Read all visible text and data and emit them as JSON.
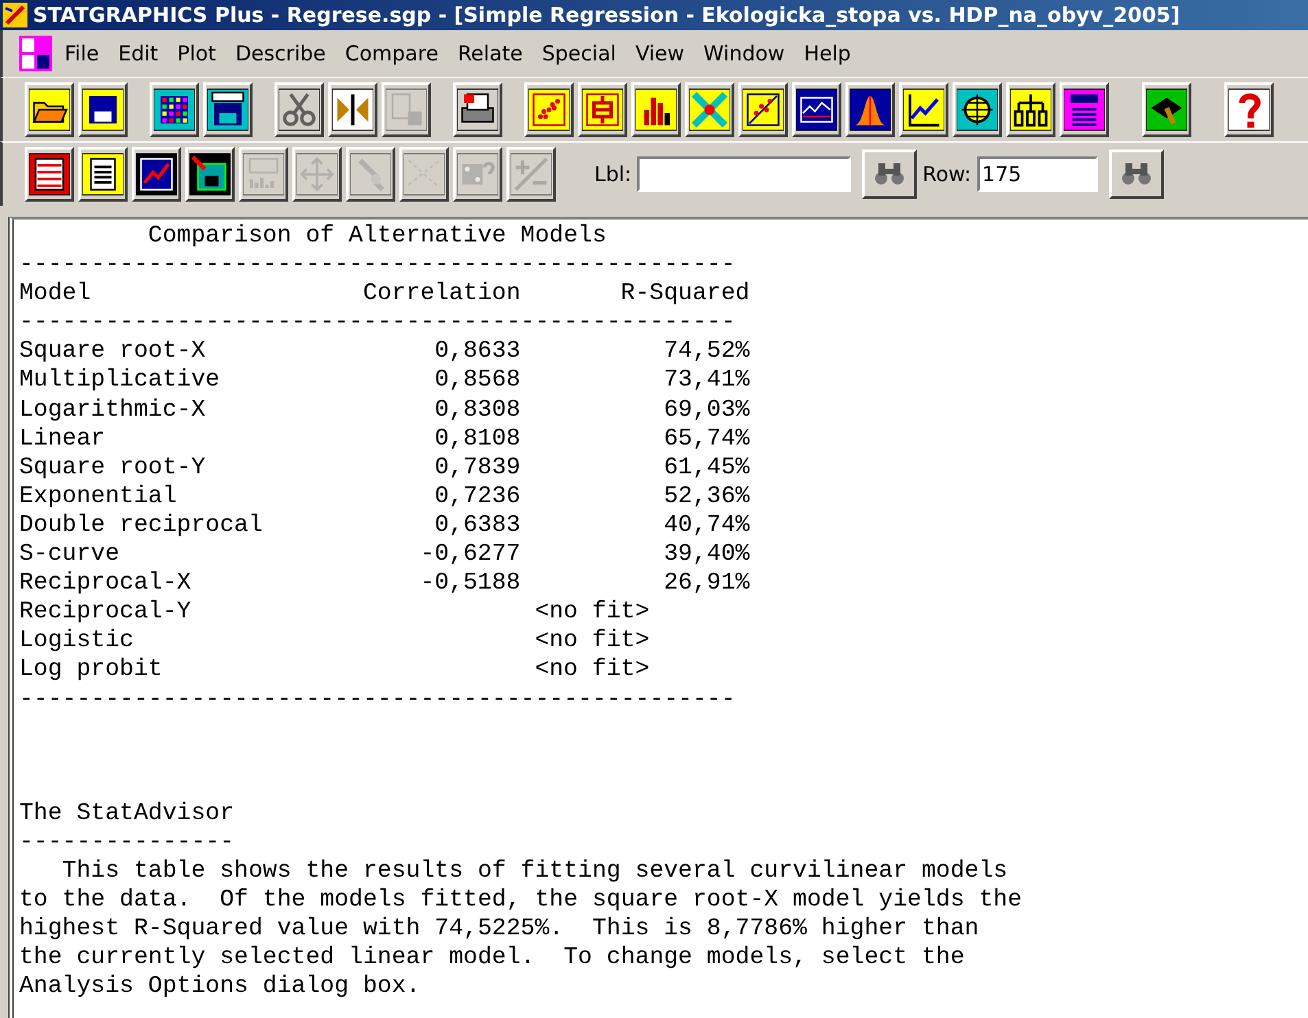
{
  "window": {
    "title": "STATGRAPHICS Plus - Regrese.sgp - [Simple Regression - Ekologicka_stopa vs. HDP_na_obyv_2005]"
  },
  "menu": [
    "File",
    "Edit",
    "Plot",
    "Describe",
    "Compare",
    "Relate",
    "Special",
    "View",
    "Window",
    "Help"
  ],
  "toolbar_1": [
    {
      "disabled": false
    },
    {
      "disabled": false
    },
    {
      "disabled": false
    },
    {
      "disabled": false
    },
    {
      "disabled": false
    },
    {
      "disabled": false
    },
    {
      "disabled": true
    },
    {
      "disabled": false
    },
    {
      "disabled": false
    },
    {
      "disabled": false
    },
    {
      "disabled": false
    },
    {
      "disabled": false
    },
    {
      "disabled": false
    },
    {
      "disabled": false
    },
    {
      "disabled": false
    },
    {
      "disabled": false
    },
    {
      "disabled": false
    },
    {
      "disabled": false
    },
    {
      "disabled": false
    },
    {
      "disabled": false
    },
    {
      "disabled": false
    }
  ],
  "toolbar_2": {
    "buttons": [
      {
        "disabled": false
      },
      {
        "disabled": false
      },
      {
        "disabled": false
      },
      {
        "disabled": false
      },
      {
        "disabled": true
      },
      {
        "disabled": true
      },
      {
        "disabled": true
      },
      {
        "disabled": true
      },
      {
        "disabled": true
      },
      {
        "disabled": true
      }
    ],
    "label_field": {
      "label": "Lbl:"
    },
    "row_field": {
      "label": "Row:",
      "value": "175"
    }
  },
  "report": {
    "title": "Comparison of Alternative Models",
    "rule": "--------------------------------------------------",
    "columns": [
      "Model",
      "Correlation",
      "R-Squared"
    ],
    "rows": [
      {
        "kind": "fit",
        "model": "Square root-X",
        "correlation": "0,8633",
        "r_squared": "74,52%"
      },
      {
        "kind": "fit",
        "model": "Multiplicative",
        "correlation": "0,8568",
        "r_squared": "73,41%"
      },
      {
        "kind": "fit",
        "model": "Logarithmic-X",
        "correlation": "0,8308",
        "r_squared": "69,03%"
      },
      {
        "kind": "fit",
        "model": "Linear",
        "correlation": "0,8108",
        "r_squared": "65,74%"
      },
      {
        "kind": "fit",
        "model": "Square root-Y",
        "correlation": "0,7839",
        "r_squared": "61,45%"
      },
      {
        "kind": "fit",
        "model": "Exponential",
        "correlation": "0,7236",
        "r_squared": "52,36%"
      },
      {
        "kind": "fit",
        "model": "Double reciprocal",
        "correlation": "0,6383",
        "r_squared": "40,74%"
      },
      {
        "kind": "fit",
        "model": "S-curve",
        "correlation": "-0,6277",
        "r_squared": "39,40%"
      },
      {
        "kind": "fit",
        "model": "Reciprocal-X",
        "correlation": "-0,5188",
        "r_squared": "26,91%"
      },
      {
        "kind": "no_fit",
        "model": "Reciprocal-Y",
        "result": "<no fit>"
      },
      {
        "kind": "no_fit",
        "model": "Logistic",
        "result": "<no fit>"
      },
      {
        "kind": "no_fit",
        "model": "Log probit",
        "result": "<no fit>"
      }
    ],
    "advisor": {
      "title": "The StatAdvisor",
      "rule": "---------------",
      "lines": [
        "   This table shows the results of fitting several curvilinear models",
        "to the data.  Of the models fitted, the square root-X model yields the",
        "highest R-Squared value with 74,5225%.  This is 8,7786% higher than",
        "the currently selected linear model.  To change models, select the",
        "Analysis Options dialog box."
      ]
    }
  }
}
